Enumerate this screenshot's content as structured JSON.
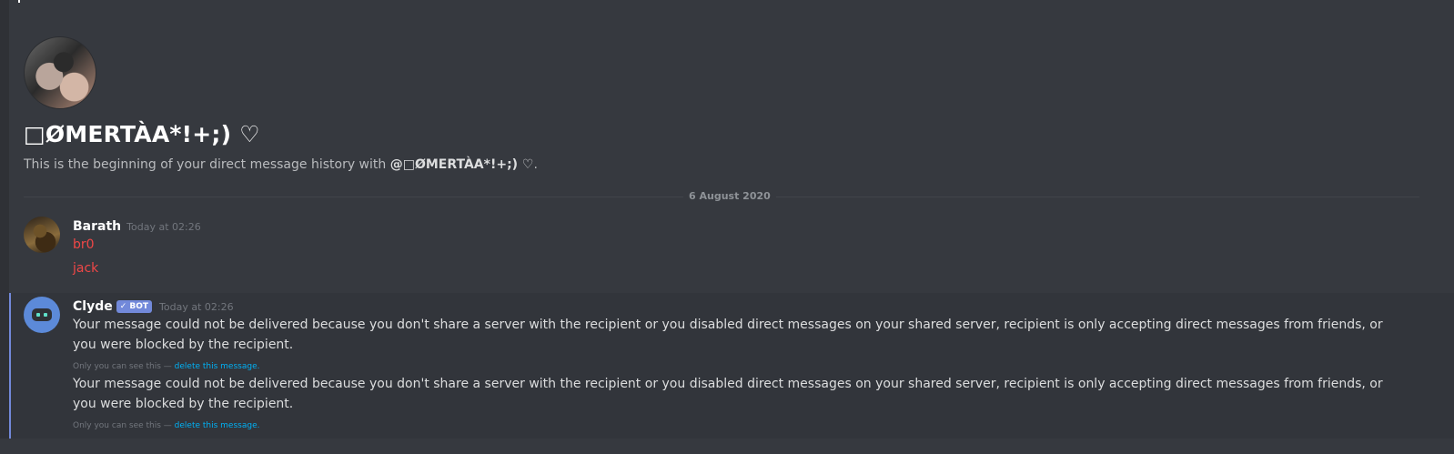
{
  "dm_header": {
    "title": "□ØMERTÀA*!+;) ♡",
    "intro_prefix": "This is the beginning of your direct message history with ",
    "intro_user": "@□ØMERTÀA*!+;) ♡",
    "intro_suffix": "."
  },
  "date_divider": "6 August 2020",
  "messages": [
    {
      "author": "Barath",
      "timestamp": "Today at 02:26",
      "lines": [
        "br0",
        "jack"
      ]
    },
    {
      "author": "Clyde",
      "bot_tag": "✓ BOT",
      "timestamp": "Today at 02:26",
      "texts": [
        "Your message could not be delivered because you don't share a server with the recipient or you disabled direct messages on your shared server, recipient is only accepting direct messages from friends, or you were blocked by the recipient.",
        "Your message could not be delivered because you don't share a server with the recipient or you disabled direct messages on your shared server, recipient is only accepting direct messages from friends, or you were blocked by the recipient."
      ],
      "ephemeral_note": "Only you can see this — ",
      "ephemeral_link": "delete this message."
    }
  ],
  "colors": {
    "background": "#36393f",
    "mention_red": "#f04747",
    "link_blue": "#00b0f4",
    "bot_tag": "#7289da"
  }
}
